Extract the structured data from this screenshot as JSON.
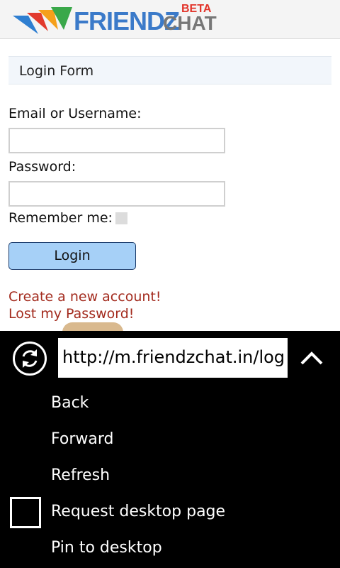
{
  "header": {
    "logo_main": "FRIENDZ",
    "logo_beta": "BETA",
    "logo_chat": "CHAT"
  },
  "form": {
    "title": "Login Form",
    "email_label": "Email or Username:",
    "email_value": "",
    "password_label": "Password:",
    "password_value": "",
    "remember_label": "Remember me:",
    "remember_checked": false,
    "login_label": "Login",
    "create_account_link": "Create a new account!",
    "lost_password_link": "Lost my Password!"
  },
  "browser_menu": {
    "url": "http://m.friendzchat.in/log",
    "items": [
      "Back",
      "Forward",
      "Refresh",
      "Request desktop page",
      "Pin to desktop"
    ],
    "request_desktop_checked": false,
    "refresh_icon": "refresh-icon",
    "collapse_icon": "chevron-up-icon"
  }
}
